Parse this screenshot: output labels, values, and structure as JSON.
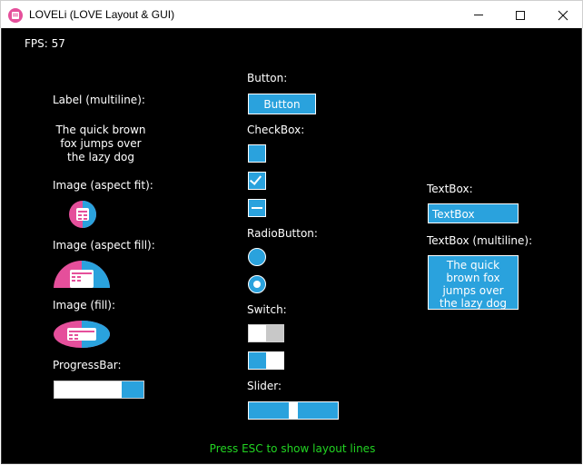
{
  "window": {
    "title": "LOVELi (LOVE Layout & GUI)"
  },
  "fps": "FPS: 57",
  "left_column": {
    "label_heading": "Label (multiline):",
    "label_text": "The quick brown fox jumps over the lazy dog",
    "image_fit_label": "Image (aspect fit):",
    "image_fill_aspect_label": "Image (aspect fill):",
    "image_fill_label": "Image (fill):",
    "progress_label": "ProgressBar:",
    "progress_value": 0.25
  },
  "middle_column": {
    "button_heading": "Button:",
    "button_label": "Button",
    "checkbox_heading": "CheckBox:",
    "checkbox_states": [
      "unchecked",
      "checked",
      "indeterminate"
    ],
    "radio_heading": "RadioButton:",
    "radio_states": [
      "unselected",
      "selected"
    ],
    "switch_heading": "Switch:",
    "switch_states": [
      "off",
      "on"
    ],
    "slider_heading": "Slider:",
    "slider_value": 0.5
  },
  "right_column": {
    "textbox_heading": "TextBox:",
    "textbox_value": "TextBox",
    "textarea_heading": "TextBox (multiline):",
    "textarea_value": "The quick brown fox jumps over the lazy dog"
  },
  "hint": "Press ESC to show layout lines",
  "colors": {
    "accent": "#2aa2dd",
    "pink": "#e54f9b",
    "hint": "#22d322",
    "background": "#000000"
  },
  "icons": [
    "app-icon",
    "minimize-icon",
    "maximize-icon",
    "close-icon",
    "checkmark-icon",
    "dash-icon",
    "radio-dot-icon"
  ]
}
